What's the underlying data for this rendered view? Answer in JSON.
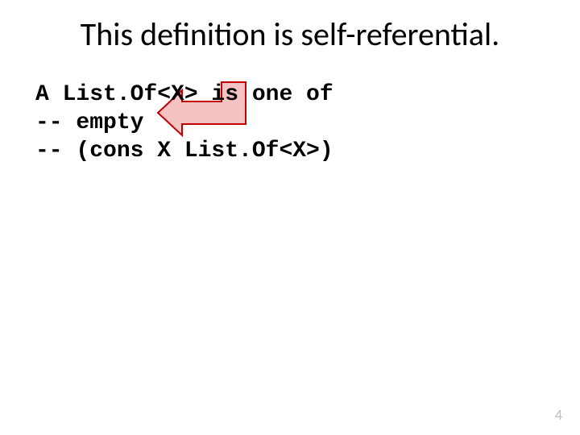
{
  "title": "This definition is self-referential.",
  "code": {
    "line1": "A List.Of<X> is one of",
    "line2": "-- empty",
    "line3": "-- (cons X List.Of<X>)"
  },
  "arrow": {
    "fill": "#f4c2c2",
    "stroke": "#c00000"
  },
  "page_number": "4"
}
